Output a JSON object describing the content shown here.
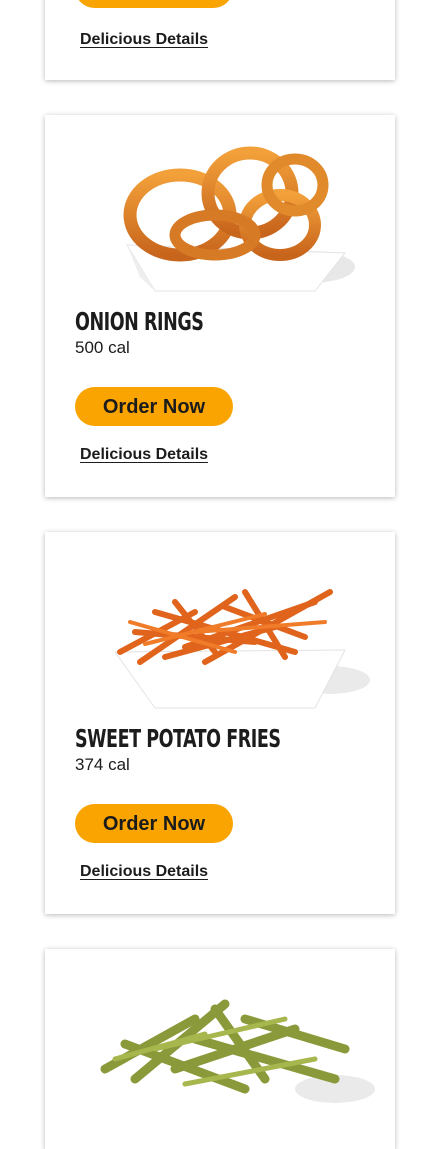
{
  "colors": {
    "accent": "#f9a400",
    "text": "#1c1c1c",
    "card_bg": "#ffffff"
  },
  "cards": [
    {
      "name": "",
      "calories": "",
      "order_label": "",
      "details_label": "Delicious Details"
    },
    {
      "name": "ONION RINGS",
      "calories": "500 cal",
      "order_label": "Order Now",
      "details_label": "Delicious Details",
      "image_icon": "onion-rings-image"
    },
    {
      "name": "SWEET POTATO FRIES",
      "calories": "374 cal",
      "order_label": "Order Now",
      "details_label": "Delicious Details",
      "image_icon": "sweet-potato-fries-image"
    },
    {
      "name": "",
      "calories": "",
      "order_label": "",
      "details_label": "",
      "image_icon": "green-bean-fries-image"
    }
  ]
}
